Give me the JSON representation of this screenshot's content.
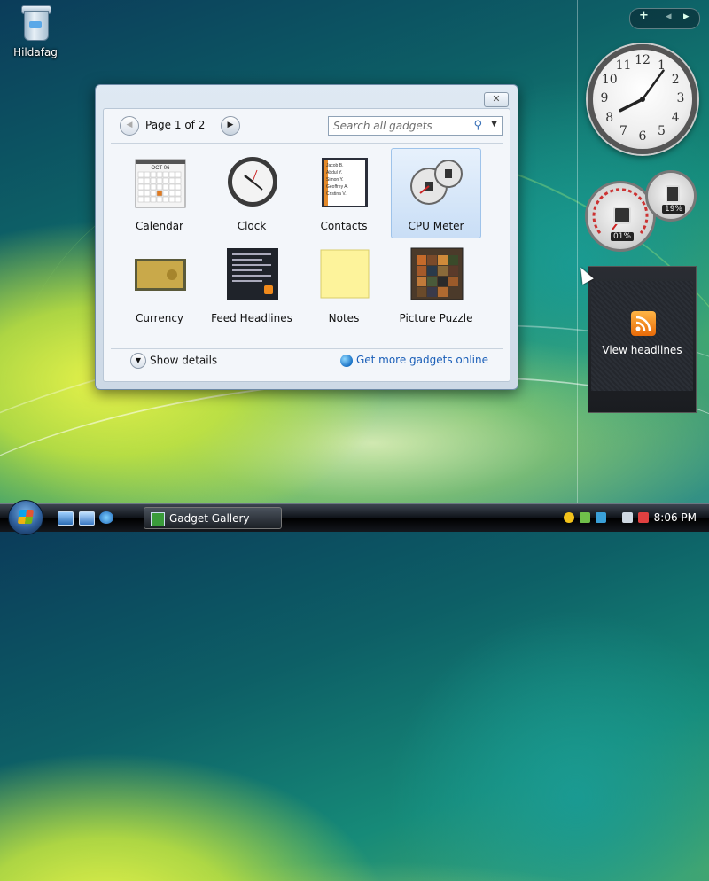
{
  "desktop": {
    "recycle_bin_label": "Hildafag"
  },
  "sidebar": {
    "controls": {
      "add": "+",
      "prev": "◂",
      "next": "▸"
    },
    "clock": {
      "numbers": [
        "12",
        "1",
        "2",
        "3",
        "4",
        "5",
        "6",
        "7",
        "8",
        "9",
        "10",
        "11"
      ],
      "hour": 8,
      "minute": 6
    },
    "cpu_meter": {
      "cpu_percent_label": "01%",
      "memory_percent_label": "19%"
    },
    "feed": {
      "view_label": "View headlines",
      "icon": "rss-icon"
    }
  },
  "gallery": {
    "close_symbol": "✕",
    "page_label": "Page 1 of 2",
    "search_placeholder": "Search all gadgets",
    "gadgets": [
      {
        "label": "Calendar",
        "icon": "calendar-icon",
        "selected": false
      },
      {
        "label": "Clock",
        "icon": "clock-icon",
        "selected": false
      },
      {
        "label": "Contacts",
        "icon": "contacts-icon",
        "selected": false
      },
      {
        "label": "CPU Meter",
        "icon": "cpu-meter-icon",
        "selected": true
      },
      {
        "label": "Currency",
        "icon": "currency-icon",
        "selected": false
      },
      {
        "label": "Feed Headlines",
        "icon": "feed-headlines-icon",
        "selected": false
      },
      {
        "label": "Notes",
        "icon": "notes-icon",
        "selected": false
      },
      {
        "label": "Picture Puzzle",
        "icon": "picture-puzzle-icon",
        "selected": false
      }
    ],
    "show_details": "Show details",
    "get_more": "Get more gadgets online",
    "calendar_month": "OCT 06",
    "contacts_names": [
      "Jacob B.",
      "Abdul Y.",
      "Simon Y.",
      "Geoffrey A.",
      "Cristina V."
    ]
  },
  "taskbar": {
    "window_button": "Gadget Gallery",
    "clock": "8:06 PM"
  },
  "colors": {
    "accent": "#1b5fb8",
    "selection": "#c9def6",
    "taskbar": "#10141a"
  }
}
